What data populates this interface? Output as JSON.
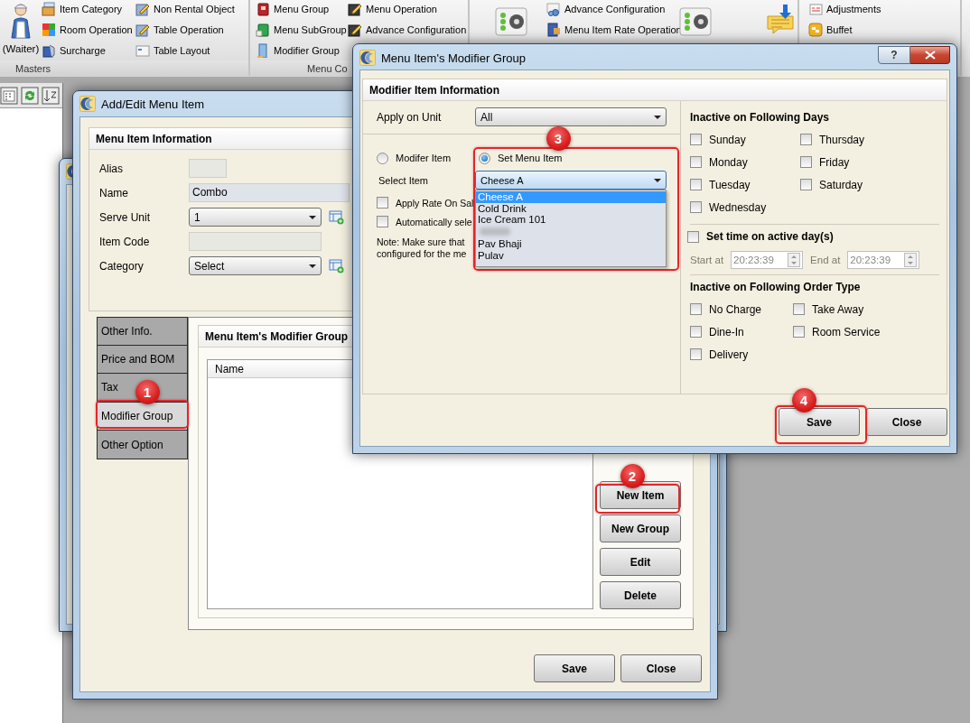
{
  "ribbon": {
    "groups": [
      {
        "label": "Masters",
        "big_label": "(Waiter)",
        "items": [
          {
            "label": "Item Category"
          },
          {
            "label": "Room Operation"
          },
          {
            "label": "Surcharge"
          },
          {
            "label": "Non Rental Object"
          },
          {
            "label": "Table Operation"
          },
          {
            "label": "Table Layout"
          }
        ]
      },
      {
        "label": "Menu Co",
        "items": [
          {
            "label": "Menu Group"
          },
          {
            "label": "Menu SubGroup"
          },
          {
            "label": "Modifier Group"
          },
          {
            "label": "Menu Operation"
          },
          {
            "label": "Advance Configuration"
          }
        ]
      },
      {
        "items": [
          {
            "label": "Advance Configuration"
          },
          {
            "label": "Menu Item Rate Operation"
          }
        ]
      },
      {
        "items": [
          {
            "label": "Adjustments"
          },
          {
            "label": "Buffet"
          }
        ]
      }
    ]
  },
  "add_edit_window": {
    "title": "Add/Edit Menu Item",
    "section_title": "Menu Item Information",
    "fields": [
      {
        "label": "Alias",
        "kind": "text"
      },
      {
        "label": "Name",
        "kind": "text",
        "value": "Combo"
      },
      {
        "label": "Serve Unit",
        "kind": "select",
        "value": "1"
      },
      {
        "label": "Item Code",
        "kind": "text"
      },
      {
        "label": "Category",
        "kind": "select",
        "value": "Select"
      }
    ],
    "tabs": [
      {
        "label": "Other Info.",
        "selected": false
      },
      {
        "label": "Price and BOM",
        "selected": false
      },
      {
        "label": "Tax",
        "selected": false
      },
      {
        "label": "Modifier Group",
        "selected": true
      },
      {
        "label": "Other Option",
        "selected": false
      }
    ],
    "panel_title": "Menu Item's Modifier Group",
    "columns": [
      "Name"
    ],
    "side_buttons": [
      {
        "label": "New Item"
      },
      {
        "label": "New Group"
      },
      {
        "label": "Edit"
      },
      {
        "label": "Delete"
      }
    ],
    "buttons": [
      {
        "label": "Save"
      },
      {
        "label": "Close"
      }
    ]
  },
  "modifier_dialog": {
    "title": "Menu Item's Modifier Group",
    "help": "?",
    "section_title": "Modifier Item Information",
    "apply_on_unit": {
      "label": "Apply on Unit",
      "value": "All"
    },
    "item_types": [
      {
        "label": "Modifer Item",
        "selected": false
      },
      {
        "label": "Set Menu Item",
        "selected": true
      }
    ],
    "select_item": {
      "label": "Select Item",
      "value": "Cheese A",
      "expanded": true,
      "options": [
        {
          "kind": "text",
          "label": "Cheese A",
          "selected": true
        },
        {
          "kind": "text",
          "label": "Cold Drink",
          "selected": false
        },
        {
          "kind": "text",
          "label": "Ice Cream 101",
          "selected": false
        },
        {
          "kind": "blurred",
          "selected": false
        },
        {
          "kind": "text",
          "label": "Pav Bhaji",
          "selected": false
        },
        {
          "kind": "text",
          "label": "Pulav",
          "selected": false
        }
      ]
    },
    "checks": [
      {
        "label": "Apply Rate On Sal",
        "checked": false
      },
      {
        "label": "Automatically sele",
        "checked": false
      }
    ],
    "note": [
      "Note: Make sure that",
      "configured for the me"
    ],
    "days_title": "Inactive on Following Days",
    "days": [
      {
        "label": "Sunday",
        "checked": false
      },
      {
        "label": "Thursday",
        "checked": false
      },
      {
        "label": "Monday",
        "checked": false
      },
      {
        "label": "Friday",
        "checked": false
      },
      {
        "label": "Tuesday",
        "checked": false
      },
      {
        "label": "Saturday",
        "checked": false
      },
      {
        "label": "Wednesday",
        "checked": false
      }
    ],
    "time": {
      "label": "Set time on active day(s)",
      "checked": false,
      "disabled": true,
      "start_label": "Start at",
      "start": "20:23:39",
      "end_label": "End at",
      "end": "20:23:39"
    },
    "order_title": "Inactive on Following Order Type",
    "order_types": [
      {
        "label": "No Charge",
        "checked": false
      },
      {
        "label": "Take Away",
        "checked": false
      },
      {
        "label": "Dine-In",
        "checked": false
      },
      {
        "label": "Room Service",
        "checked": false
      },
      {
        "label": "Delivery",
        "checked": false
      }
    ],
    "buttons": [
      {
        "label": "Save"
      },
      {
        "label": "Close"
      }
    ]
  },
  "callouts": [
    {
      "label": "1"
    },
    {
      "label": "2"
    },
    {
      "label": "3"
    },
    {
      "label": "4"
    }
  ]
}
